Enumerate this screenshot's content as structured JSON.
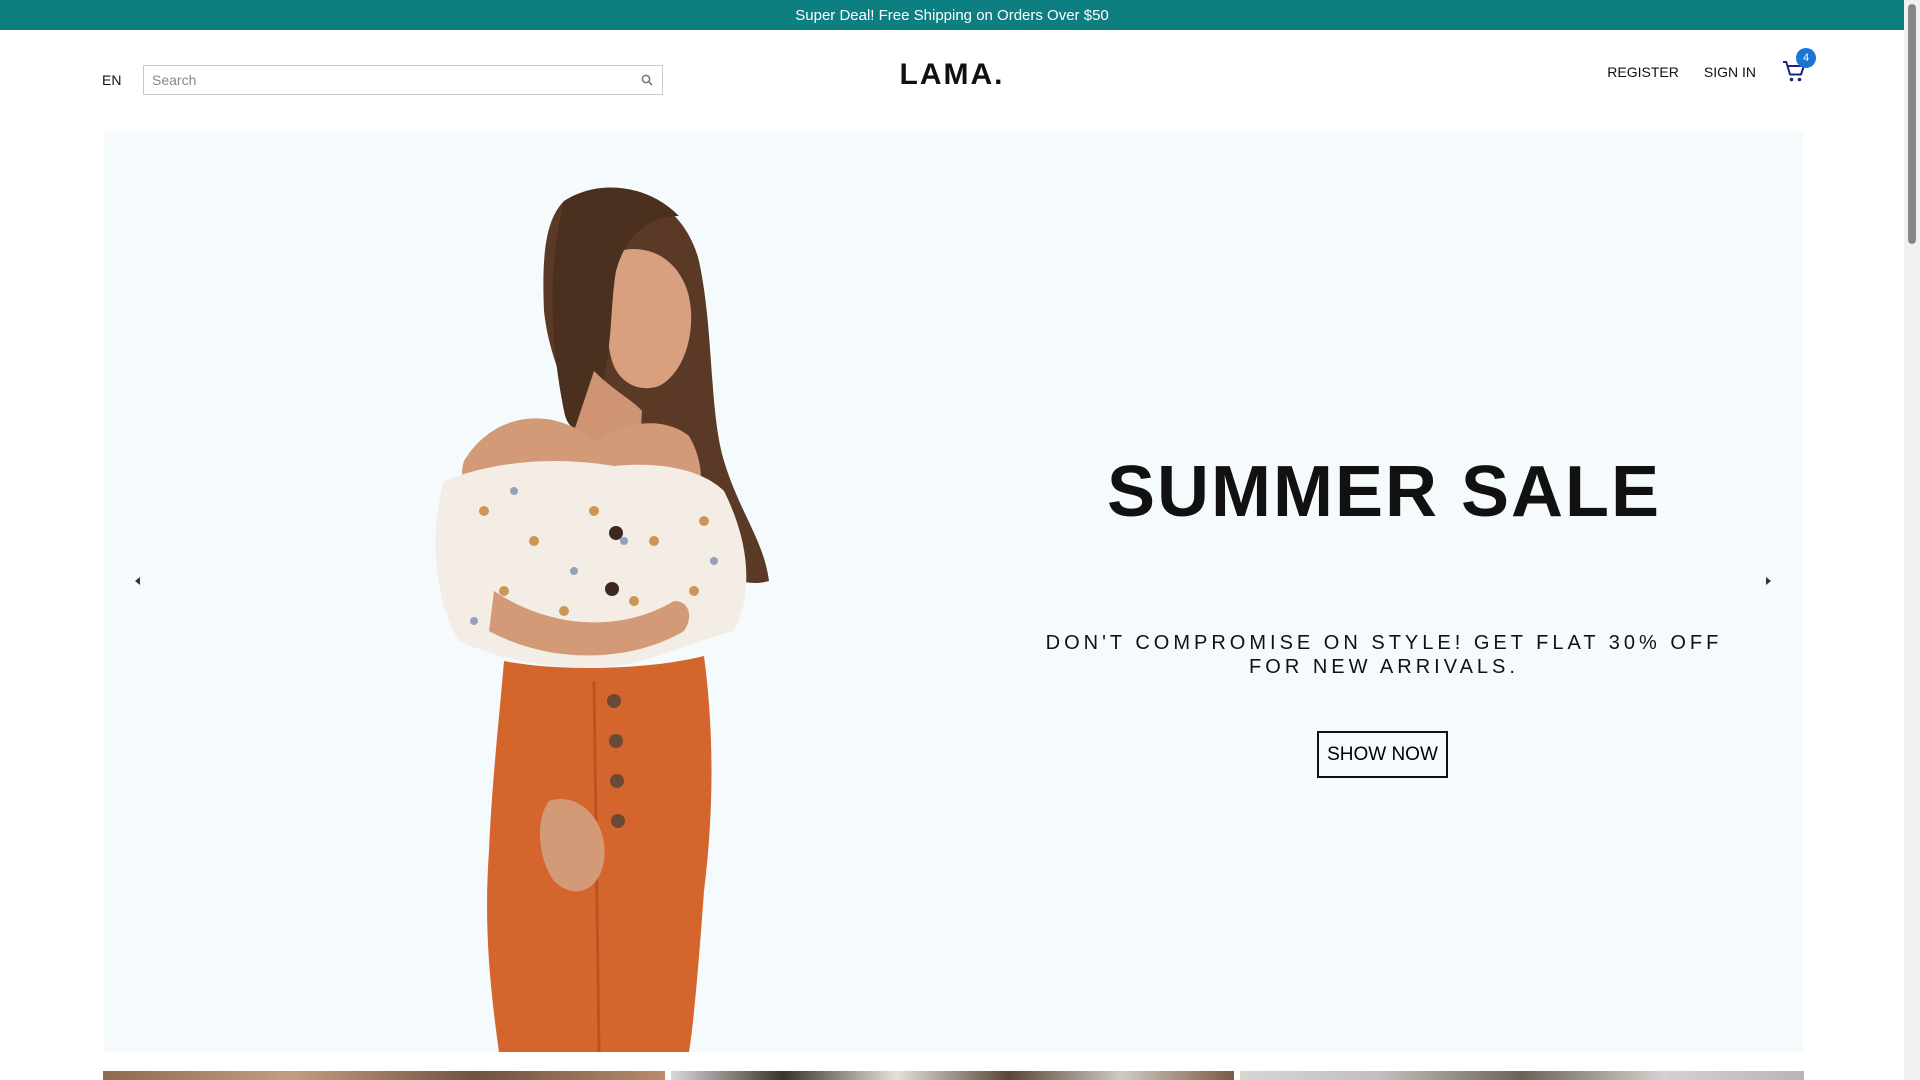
{
  "announcement": {
    "text": "Super Deal! Free Shipping on Orders Over $50"
  },
  "navbar": {
    "language": "EN",
    "search": {
      "placeholder": "Search",
      "value": ""
    },
    "logo": "LAMA.",
    "links": {
      "register": "REGISTER",
      "sign_in": "SIGN IN"
    },
    "cart": {
      "count": "4",
      "badge_color": "#1976d2"
    }
  },
  "slider": {
    "background": "#f5fafd",
    "slide": {
      "title": "SUMMER SALE",
      "description": "DON'T COMPROMISE ON STYLE! GET FLAT 30% OFF FOR NEW ARRIVALS.",
      "button_label": "SHOW NOW"
    },
    "arrows": {
      "left_icon": "arrow-left-icon",
      "right_icon": "arrow-right-icon"
    }
  },
  "colors": {
    "accent": "#0e7f80",
    "text": "#111111"
  }
}
